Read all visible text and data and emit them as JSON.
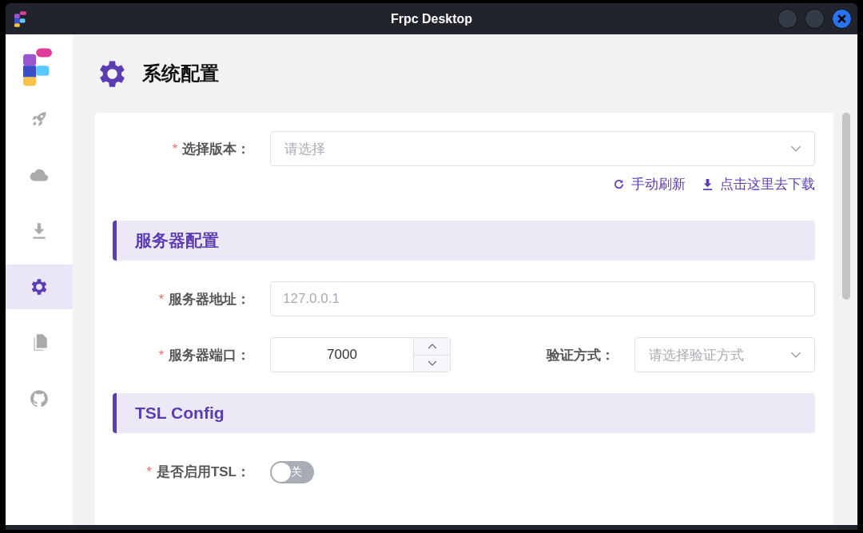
{
  "window": {
    "title": "Frpc Desktop"
  },
  "sidebar": {
    "items": [
      {
        "kind": "launch",
        "selected": false
      },
      {
        "kind": "proxy",
        "selected": false
      },
      {
        "kind": "download",
        "selected": false
      },
      {
        "kind": "settings",
        "selected": true
      },
      {
        "kind": "logs",
        "selected": false
      },
      {
        "kind": "source",
        "selected": false
      }
    ]
  },
  "page": {
    "title": "系统配置"
  },
  "form": {
    "blocks": [
      {
        "kind": "select",
        "mark": "*",
        "label": "选择版本：",
        "placeholder": "请选择"
      },
      {
        "kind": "links",
        "links": [
          {
            "kind": "refresh",
            "label": "手动刷新"
          },
          {
            "kind": "download",
            "label": "点击这里去下载"
          }
        ]
      },
      {
        "kind": "section",
        "title": "服务器配置"
      },
      {
        "kind": "input",
        "mark": "*",
        "label": "服务器地址：",
        "placeholder": "127.0.0.1"
      },
      {
        "kind": "port",
        "mark": "*",
        "label": "服务器端口：",
        "value": "7000",
        "label_2": "验证方式：",
        "placeholder_2": "请选择验证方式"
      },
      {
        "kind": "section",
        "title": "TSL Config"
      },
      {
        "kind": "switch",
        "mark": "*",
        "label": "是否启用TSL：",
        "on": false,
        "text": "关"
      }
    ]
  }
}
